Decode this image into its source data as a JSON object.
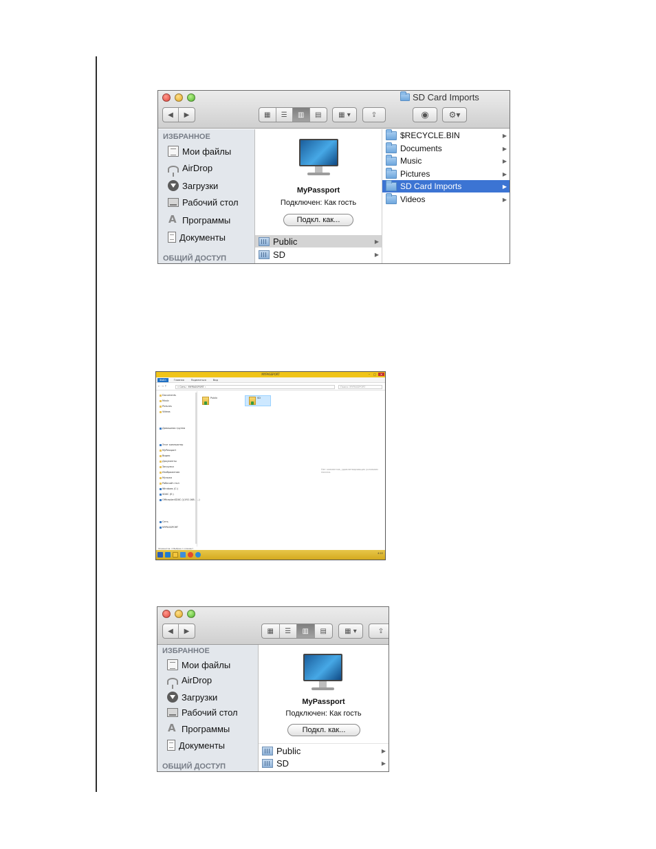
{
  "finder_top": {
    "title": "SD Card Imports",
    "sidebar": {
      "favorites_heading": "ИЗБРАННОЕ",
      "items": [
        {
          "label": "Мои файлы",
          "icon": "my-files-icon"
        },
        {
          "label": "AirDrop",
          "icon": "airdrop-icon"
        },
        {
          "label": "Загрузки",
          "icon": "downloads-icon"
        },
        {
          "label": "Рабочий стол",
          "icon": "desktop-icon"
        },
        {
          "label": "Программы",
          "icon": "applications-icon"
        },
        {
          "label": "Документы",
          "icon": "documents-icon"
        }
      ],
      "shared_heading": "ОБЩИЙ ДОСТУП"
    },
    "device": {
      "name": "MyPassport",
      "status": "Подключен: Как гость",
      "connect_label": "Подкл. как..."
    },
    "shares": [
      {
        "label": "Public",
        "selected": true
      },
      {
        "label": "SD",
        "selected": false
      }
    ],
    "folders": [
      {
        "label": "$RECYCLE.BIN",
        "selected": false
      },
      {
        "label": "Documents",
        "selected": false
      },
      {
        "label": "Music",
        "selected": false
      },
      {
        "label": "Pictures",
        "selected": false
      },
      {
        "label": "SD Card Imports",
        "selected": true
      },
      {
        "label": "Videos",
        "selected": false
      }
    ],
    "colors": {
      "selection": "#3c74d3",
      "sidebar_bg": "#e3e7ec"
    }
  },
  "explorer": {
    "title": "MYPASSPORT",
    "ribbon_tabs": [
      "Файл",
      "Главная",
      "Поделиться",
      "Вид"
    ],
    "address": "« Сеть › MYPASSPORT ›",
    "search_placeholder": "Поиск: MYPASSPORT",
    "nav_items": [
      "Documents",
      "Music",
      "Pictures",
      "Videos",
      "Домашняя группа",
      "Этот компьютер",
      "MyPassport",
      "Видео",
      "Документы",
      "Загрузки",
      "Изображения",
      "Музыка",
      "Рабочий стол",
      "Windows (C:)",
      "SDXC (E:)",
      "OfficeplanSDXC (\\\\192.168.1...)",
      "Сеть",
      "MYPASSPORT"
    ],
    "files": [
      {
        "label": "Public",
        "selected": false
      },
      {
        "label": "SD",
        "selected": true
      }
    ],
    "empty_hint": "Нет элементов, удовлетворяющих условиям поиска.",
    "status": "Элементов: 2    Выбран 1 элемент",
    "tray_time": "4:22"
  },
  "finder_bottom": {
    "sidebar": {
      "favorites_heading": "ИЗБРАННОЕ",
      "items": [
        {
          "label": "Мои файлы"
        },
        {
          "label": "AirDrop"
        },
        {
          "label": "Загрузки"
        },
        {
          "label": "Рабочий стол"
        },
        {
          "label": "Программы"
        },
        {
          "label": "Документы"
        }
      ],
      "shared_heading": "ОБЩИЙ ДОСТУП"
    },
    "device": {
      "name": "MyPassport",
      "status": "Подключен: Как гость",
      "connect_label": "Подкл. как..."
    },
    "shares": [
      {
        "label": "Public"
      },
      {
        "label": "SD"
      }
    ]
  }
}
